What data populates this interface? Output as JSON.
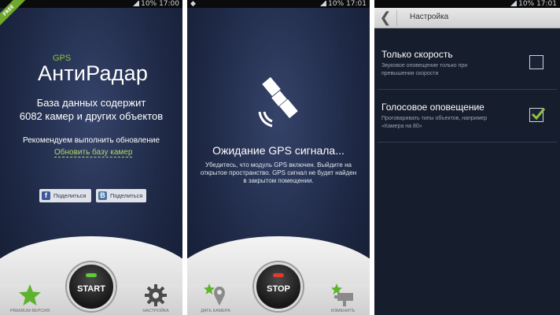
{
  "screen1": {
    "status_time": "17:00",
    "status_battery": "10%",
    "ribbon": "FREE",
    "logo_gps": "GPS",
    "logo_name": "АнтиРадар",
    "db_line1": "База данных содержит",
    "db_line2": "6082 камер и других объектов",
    "recommend": "Рекомендуем выполнить обновление",
    "update_link": "Обновить базу камер",
    "share_facebook": "Поделиться",
    "share_vk": "Поделиться",
    "start_label": "START",
    "premium_label": "PREMIUM ВЕРСИЯ",
    "settings_label": "НАСТРОЙКА"
  },
  "screen2": {
    "status_time": "17:01",
    "status_battery": "10%",
    "wait_title": "Ожидание GPS сигнала...",
    "wait_desc": "Убедитесь, что модуль GPS включен. Выйдите на открытое пространство. GPS сигнал не будет найден в закрытом помещении.",
    "stop_label": "STOP",
    "add_camera_label": "ДАТЬ КАМЕРА",
    "change_label": "ИЗМЕНИТЬ"
  },
  "screen3": {
    "status_time": "17:01",
    "status_battery": "10%",
    "title": "Настройка",
    "prefs": [
      {
        "title": "Только скорость",
        "summary": "Звуковое оповещение только при превышении скорости",
        "checked": false
      },
      {
        "title": "Голосовое оповещение",
        "summary": "Проговаривать типы объектов, например «Камера на 80»",
        "checked": true
      }
    ]
  },
  "colors": {
    "accent_green": "#8fc43f",
    "led_green": "#5ccc3a",
    "led_red": "#e23a2e",
    "link": "#b8d46a"
  },
  "icons": [
    "star-icon",
    "gear-icon",
    "satellite-icon",
    "location-pin-icon",
    "camera-icon",
    "back-icon",
    "check-icon",
    "facebook-icon",
    "vk-icon"
  ]
}
